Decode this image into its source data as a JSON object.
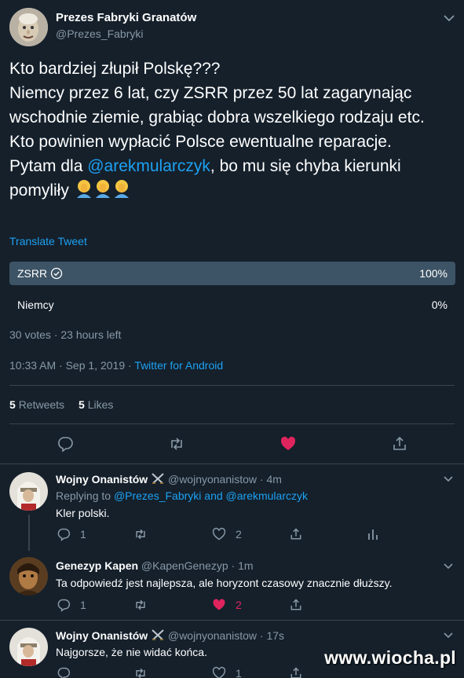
{
  "tweet": {
    "author_name": "Prezes Fabryki Granatów",
    "author_handle": "@Prezes_Fabryki",
    "text_line1": "Kto bardziej złupił Polskę???",
    "text_line2": "Niemcy przez 6 lat, czy ZSRR przez 50 lat zagarynając wschodnie ziemie, grabiąc dobra wszelkiego rodzaju etc.",
    "text_line3": "Kto powinien wypłacić Polsce ewentualne reparacje.",
    "text_line4_prefix": "Pytam dla ",
    "text_mention": "@arekmularczyk",
    "text_line4_suffix": ", bo mu się chyba kierunki pomyliły",
    "emoji": "facepalm",
    "translate_label": "Translate Tweet",
    "poll": {
      "options": [
        {
          "label": "ZSRR",
          "percent": "100%",
          "winner": true
        },
        {
          "label": "Niemcy",
          "percent": "0%",
          "winner": false
        }
      ],
      "meta": "30 votes · 23 hours left"
    },
    "timestamp": "10:33 AM · Sep 1, 2019 · ",
    "source": "Twitter for Android",
    "retweets_count": "5",
    "retweets_label": "Retweets",
    "likes_count": "5",
    "likes_label": "Likes",
    "liked": true
  },
  "replies": [
    {
      "name": "Wojny Onanistów",
      "badge_icon": "crossed-swords",
      "handle": "@wojnyonanistow",
      "time": "· 4m",
      "replying_prefix": "Replying to ",
      "replying_to": "@Prezes_Fabryki and @arekmularczyk",
      "text": "Kler polski.",
      "reply_count": "1",
      "retweet_count": "",
      "like_count": "2",
      "liked": false
    },
    {
      "name": "Genezyp Kapen",
      "handle": "@KapenGenezyp",
      "time": "· 1m",
      "text": "Ta odpowiedź jest najlepsza, ale horyzont czasowy znacznie dłuższy.",
      "reply_count": "1",
      "retweet_count": "",
      "like_count": "2",
      "liked": true
    },
    {
      "name": "Wojny Onanistów",
      "badge_icon": "crossed-swords",
      "handle": "@wojnyonanistow",
      "time": "· 17s",
      "text": "Najgorsze, że nie widać końca.",
      "reply_count": "",
      "retweet_count": "",
      "like_count": "1",
      "liked": false
    }
  ],
  "watermark": "www.wiocha.pl",
  "colors": {
    "background": "#15202b",
    "accent": "#1da1f2",
    "like": "#e0245e",
    "muted": "#8899a6",
    "poll_bar": "#3d5466"
  }
}
